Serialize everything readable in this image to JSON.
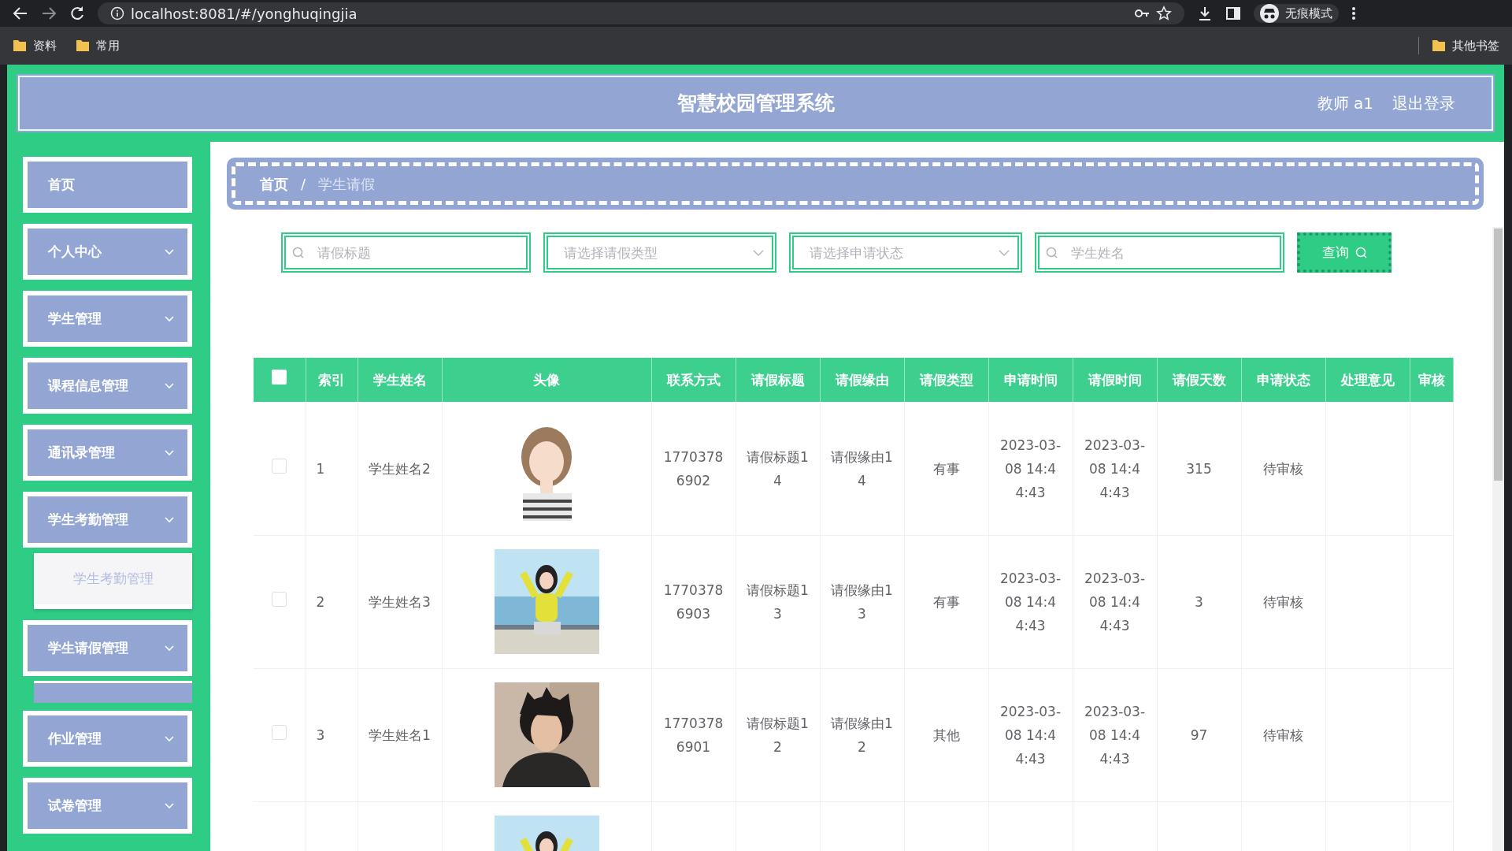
{
  "browser": {
    "url": "localhost:8081/#/yonghuqingjia",
    "profile": "无痕模式",
    "bookmarks": [
      "资料",
      "常用"
    ],
    "other_bookmarks": "其他书签"
  },
  "header": {
    "title": "智慧校园管理系统",
    "user": "教师 a1",
    "logout": "退出登录"
  },
  "sidebar": {
    "items": [
      {
        "label": "首页",
        "kind": "link"
      },
      {
        "label": "个人中心",
        "kind": "menu"
      },
      {
        "label": "学生管理",
        "kind": "menu"
      },
      {
        "label": "课程信息管理",
        "kind": "menu"
      },
      {
        "label": "通讯录管理",
        "kind": "menu"
      },
      {
        "label": "学生考勤管理",
        "kind": "menu",
        "children": [
          {
            "label": "学生考勤管理",
            "kind": "item"
          }
        ]
      },
      {
        "label": "学生请假管理",
        "kind": "menu",
        "children": [
          {
            "kind": "covered"
          }
        ]
      },
      {
        "label": "作业管理",
        "kind": "menu"
      },
      {
        "label": "试卷管理",
        "kind": "menu"
      }
    ]
  },
  "breadcrumb": {
    "items": [
      "首页",
      "学生请假"
    ],
    "separator": "/"
  },
  "filters": [
    {
      "kind": "search",
      "placeholder": "请假标题"
    },
    {
      "kind": "select",
      "placeholder": "请选择请假类型"
    },
    {
      "kind": "select",
      "placeholder": "请选择申请状态"
    },
    {
      "kind": "search",
      "placeholder": "学生姓名"
    }
  ],
  "query_button": "查询",
  "table": {
    "header_checkbox": {
      "checked": false
    },
    "columns": [
      "索引",
      "学生姓名",
      "头像",
      "联系方式",
      "请假标题",
      "请假缘由",
      "请假类型",
      "申请时间",
      "请假时间",
      "请假天数",
      "申请状态",
      "处理意见",
      "审核"
    ],
    "rows": [
      {
        "checked": false,
        "cells": [
          "1",
          "学生姓名2",
          "",
          "17703786902",
          "请假标题14",
          "请假缘由14",
          "有事",
          "2023-03-08 14:44:43",
          "2023-03-08 14:44:43",
          "315",
          "待审核",
          "",
          ""
        ],
        "avatar": {
          "kind": "picture"
        }
      },
      {
        "checked": false,
        "cells": [
          "2",
          "学生姓名3",
          "",
          "17703786903",
          "请假标题13",
          "请假缘由13",
          "有事",
          "2023-03-08 14:44:43",
          "2023-03-08 14:44:43",
          "3",
          "待审核",
          "",
          ""
        ],
        "avatar": {
          "kind": "picture"
        }
      },
      {
        "checked": false,
        "cells": [
          "3",
          "学生姓名1",
          "",
          "17703786901",
          "请假标题12",
          "请假缘由12",
          "其他",
          "2023-03-08 14:44:43",
          "2023-03-08 14:44:43",
          "97",
          "待审核",
          "",
          ""
        ],
        "avatar": {
          "kind": "picture"
        }
      },
      {
        "avatar": {
          "kind": "picture"
        }
      }
    ]
  }
}
